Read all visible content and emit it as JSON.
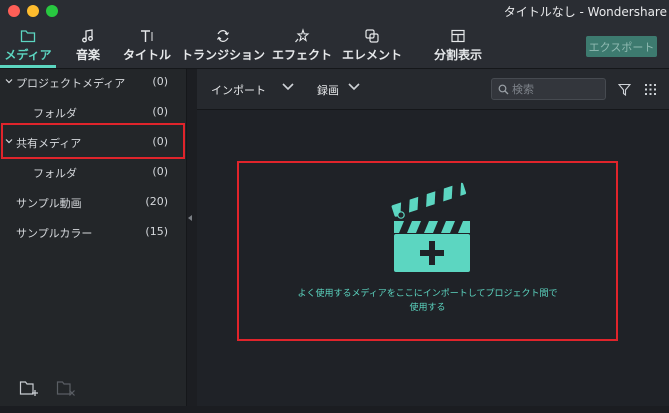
{
  "window": {
    "title": "タイトルなし - Wondershare"
  },
  "toolbar": {
    "tabs": [
      {
        "label": "メディア",
        "icon": "folder-icon",
        "active": true
      },
      {
        "label": "音楽",
        "icon": "music-note-icon",
        "active": false
      },
      {
        "label": "タイトル",
        "icon": "title-text-icon",
        "active": false
      },
      {
        "label": "トランジション",
        "icon": "transition-icon",
        "active": false
      },
      {
        "label": "エフェクト",
        "icon": "effects-icon",
        "active": false
      },
      {
        "label": "エレメント",
        "icon": "elements-icon",
        "active": false
      },
      {
        "label": "分割表示",
        "icon": "split-screen-icon",
        "active": false
      }
    ],
    "export_label": "エクスポート"
  },
  "sidebar": {
    "items": [
      {
        "label": "プロジェクトメディア",
        "count": "(0)",
        "expandable": true
      },
      {
        "label": "フォルダ",
        "count": "(0)",
        "expandable": false
      },
      {
        "label": "共有メディア",
        "count": "(0)",
        "expandable": true
      },
      {
        "label": "フォルダ",
        "count": "(0)",
        "expandable": false
      },
      {
        "label": "サンプル動画",
        "count": "(20)",
        "expandable": false
      },
      {
        "label": "サンプルカラー",
        "count": "(15)",
        "expandable": false
      }
    ],
    "bottom_icons": [
      "new-folder-icon",
      "delete-folder-icon"
    ]
  },
  "main": {
    "import_label": "インポート",
    "record_label": "録画",
    "search_placeholder": "検索",
    "drop_hint_line1": "よく使用するメディアをここにインポートしてプロジェクト間で",
    "drop_hint_line2": "使用する"
  },
  "colors": {
    "accent": "#5cd6c1",
    "highlight": "#e0242b",
    "background": "#1f2227",
    "panel": "#2a2d33"
  }
}
